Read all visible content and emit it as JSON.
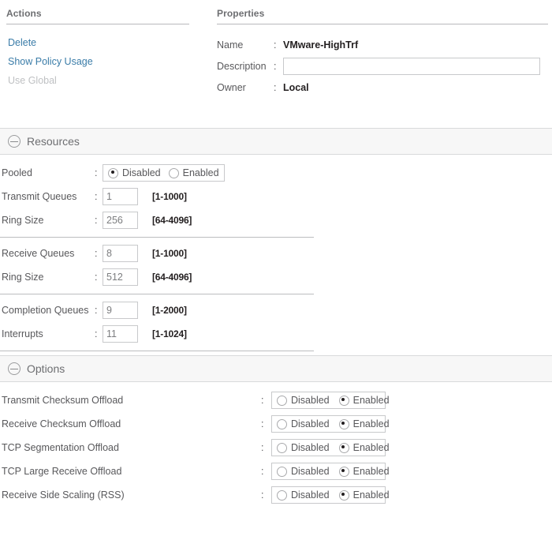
{
  "actions_panel": {
    "title": "Actions",
    "links": [
      {
        "label": "Delete",
        "enabled": true
      },
      {
        "label": "Show Policy Usage",
        "enabled": true
      },
      {
        "label": "Use Global",
        "enabled": false
      }
    ]
  },
  "properties_panel": {
    "title": "Properties",
    "name_label": "Name",
    "name_value": "VMware-HighTrf",
    "description_label": "Description",
    "description_value": "",
    "description_placeholder": "",
    "owner_label": "Owner",
    "owner_value": "Local",
    "colon": ":"
  },
  "resources_section": {
    "title": "Resources",
    "collapse_icon": "minus-circle-icon",
    "pooled": {
      "label": "Pooled",
      "colon": ":",
      "options": [
        "Disabled",
        "Enabled"
      ],
      "selected": "Disabled"
    },
    "groups": [
      {
        "rows": [
          {
            "label": "Transmit Queues",
            "colon": ":",
            "value": "1",
            "range": "[1-1000]"
          },
          {
            "label": "Ring Size",
            "colon": ":",
            "value": "256",
            "range": "[64-4096]"
          }
        ]
      },
      {
        "rows": [
          {
            "label": "Receive Queues",
            "colon": ":",
            "value": "8",
            "range": "[1-1000]"
          },
          {
            "label": "Ring Size",
            "colon": ":",
            "value": "512",
            "range": "[64-4096]"
          }
        ]
      },
      {
        "rows": [
          {
            "label": "Completion Queues",
            "colon": ":",
            "value": "9",
            "range": "[1-2000]"
          },
          {
            "label": "Interrupts",
            "colon": ":",
            "value": "11",
            "range": "[1-1024]"
          }
        ]
      }
    ]
  },
  "options_section": {
    "title": "Options",
    "collapse_icon": "minus-circle-icon",
    "radio_options": [
      "Disabled",
      "Enabled"
    ],
    "rows": [
      {
        "label": "Transmit Checksum Offload",
        "colon": ":",
        "selected": "Enabled"
      },
      {
        "label": "Receive Checksum Offload",
        "colon": ":",
        "selected": "Enabled"
      },
      {
        "label": "TCP Segmentation Offload",
        "colon": ":",
        "selected": "Enabled"
      },
      {
        "label": "TCP Large Receive Offload",
        "colon": ":",
        "selected": "Enabled"
      },
      {
        "label": "Receive Side Scaling (RSS)",
        "colon": ":",
        "selected": "Enabled"
      }
    ]
  },
  "colors": {
    "link": "#3a7ca8",
    "link_disabled": "#bfc1c3",
    "label_text": "#58585b",
    "value_text": "#231f20",
    "section_bg": "#f7f7f7",
    "border": "#c8c9cb"
  }
}
